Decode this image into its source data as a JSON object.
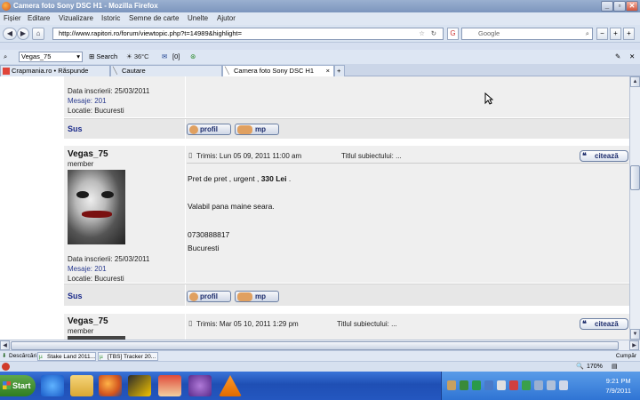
{
  "window": {
    "title": "Camera foto Sony DSC H1 - Mozilla Firefox"
  },
  "menu": [
    "Fișier",
    "Editare",
    "Vizualizare",
    "Istoric",
    "Semne de carte",
    "Unelte",
    "Ajutor"
  ],
  "nav": {
    "url": "http://www.rapitori.ro/forum/viewtopic.php?t=14989&highlight=",
    "search_placeholder": "Google"
  },
  "toolbar": {
    "profile": "Vegas_75",
    "search": "Search",
    "weather": "36°C",
    "mail": "[0]"
  },
  "tabs": [
    {
      "label": "Crapmania.ro • Răspunde",
      "active": false
    },
    {
      "label": "Cautare",
      "active": false
    },
    {
      "label": "Camera foto Sony DSC H1",
      "active": true
    }
  ],
  "post0": {
    "joined": "Data inscrierii: 25/03/2011",
    "messages": "Mesaje: 201",
    "location": "Locatie: Bucuresti",
    "sus": "Sus",
    "profil": "profil",
    "mp": "mp"
  },
  "post1": {
    "username": "Vegas_75",
    "rank": "member",
    "header_date": "Trimis: Lun 05 09, 2011 11:00 am",
    "header_subject": "Titlul subiectului: ...",
    "quote": "citează",
    "line1_prefix": "Pret de pret , urgent , ",
    "line1_price": "330 Lei",
    "line1_suffix": " .",
    "line2": "Valabil pana maine seara.",
    "line3": "0730888817",
    "line4": "Bucuresti",
    "joined": "Data inscrierii: 25/03/2011",
    "messages": "Mesaje: 201",
    "location": "Locatie: Bucuresti",
    "sus": "Sus",
    "profil": "profil",
    "mp": "mp"
  },
  "post2": {
    "username": "Vegas_75",
    "rank": "member",
    "header_date": "Trimis: Mar 05 10, 2011 1:29 pm",
    "header_subject": "Titlul subiectului: ...",
    "quote": "citează"
  },
  "downloads": {
    "label": "Descărcări",
    "items": [
      "Stake Land 2011...",
      "[TBS] Tracker 20..."
    ],
    "right": "Cumpăr"
  },
  "status": {
    "zoom": "170%"
  },
  "taskbar": {
    "start": "Start",
    "time": "9:21 PM",
    "date": "7/9/2011"
  }
}
